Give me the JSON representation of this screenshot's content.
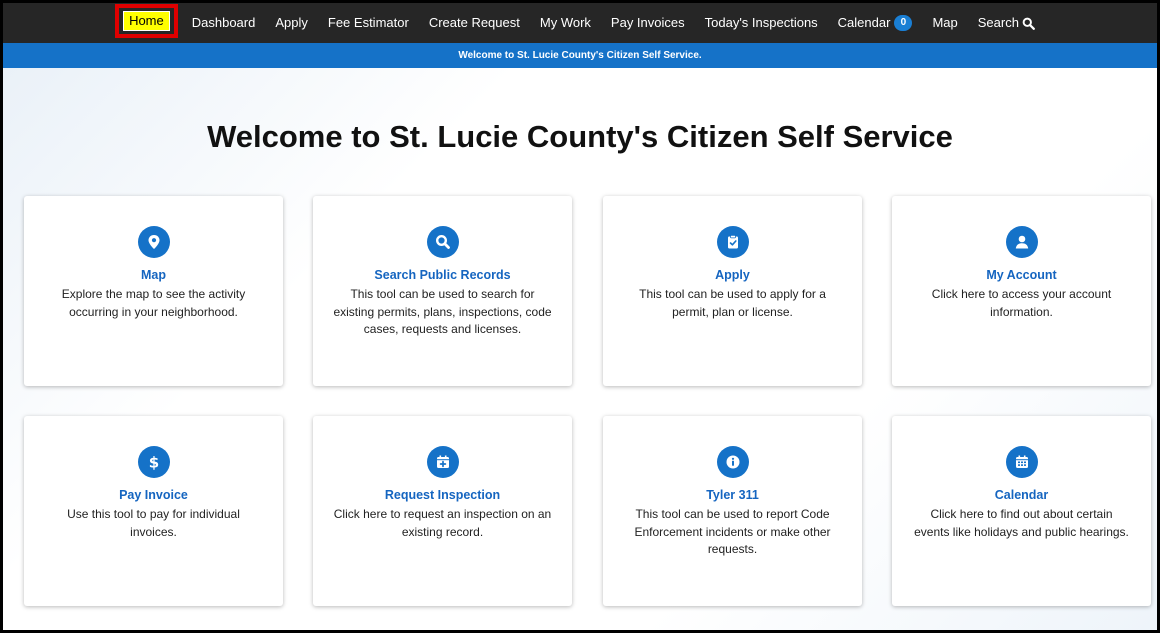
{
  "nav": {
    "home": "Home",
    "dashboard": "Dashboard",
    "apply": "Apply",
    "fee_estimator": "Fee Estimator",
    "create_request": "Create Request",
    "my_work": "My Work",
    "pay_invoices": "Pay Invoices",
    "todays_inspections": "Today's Inspections",
    "calendar": "Calendar",
    "calendar_count": "0",
    "map": "Map",
    "search": "Search"
  },
  "banner": "Welcome to St. Lucie County's Citizen Self Service.",
  "welcome_title": "Welcome to St. Lucie County's Citizen Self Service",
  "cards": [
    {
      "icon": "map-pin-icon",
      "title": "Map",
      "desc": "Explore the map to see the activity occurring in your neighborhood."
    },
    {
      "icon": "search-icon",
      "title": "Search Public Records",
      "desc": "This tool can be used to search for existing permits, plans, inspections, code cases, requests and licenses."
    },
    {
      "icon": "clipboard-check-icon",
      "title": "Apply",
      "desc": "This tool can be used to apply for a permit, plan or license."
    },
    {
      "icon": "user-icon",
      "title": "My Account",
      "desc": "Click here to access your account information."
    },
    {
      "icon": "dollar-icon",
      "title": "Pay Invoice",
      "desc": "Use this tool to pay for individual invoices."
    },
    {
      "icon": "calendar-plus-icon",
      "title": "Request Inspection",
      "desc": "Click here to request an inspection on an existing record."
    },
    {
      "icon": "info-icon",
      "title": "Tyler 311",
      "desc": "This tool can be used to report Code Enforcement incidents or make other requests."
    },
    {
      "icon": "calendar-icon",
      "title": "Calendar",
      "desc": "Click here to find out about certain events like holidays and public hearings."
    }
  ],
  "colors": {
    "accent": "#1572c8",
    "nav_bg": "#262626",
    "highlight": "#ffff00",
    "annotation": "#e00000"
  }
}
